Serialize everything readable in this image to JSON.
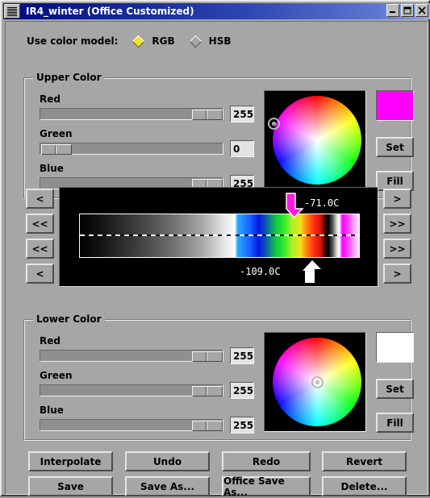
{
  "window": {
    "title": "IR4_winter (Office Customized)",
    "sysmenu_icon": "menu-lines-icon",
    "minimize_label": "minimize-icon",
    "maximize_label": "maximize-icon",
    "close_label": "close-icon",
    "titlebar_color": "#2a44b0",
    "face_color": "#a6a6a6"
  },
  "color_model": {
    "label": "Use color model:",
    "options": [
      {
        "label": "RGB",
        "selected": true,
        "marker_color": "#f5e32a"
      },
      {
        "label": "HSB",
        "selected": false,
        "marker_color": "#a6a6a6"
      }
    ]
  },
  "upper_color": {
    "group_label": "Upper Color",
    "channels": [
      {
        "label": "Red",
        "value": "255",
        "percent": 100
      },
      {
        "label": "Green",
        "value": "0",
        "percent": 0
      },
      {
        "label": "Blue",
        "value": "255",
        "percent": 100
      }
    ],
    "swatch_color": "#ff00ff",
    "cursor": {
      "x_pct": 8,
      "y_pct": 30
    },
    "set_label": "Set",
    "fill_label": "Fill"
  },
  "lower_color": {
    "group_label": "Lower Color",
    "channels": [
      {
        "label": "Red",
        "value": "255",
        "percent": 100
      },
      {
        "label": "Green",
        "value": "255",
        "percent": 100
      },
      {
        "label": "Blue",
        "value": "255",
        "percent": 100
      }
    ],
    "swatch_color": "#ffffff",
    "cursor": {
      "x_pct": 50,
      "y_pct": 50
    },
    "set_label": "Set",
    "fill_label": "Fill"
  },
  "spectrum": {
    "upper_marker": {
      "label": "-71.0C",
      "color": "#ff1ae0",
      "position_pct": 79.5
    },
    "lower_marker": {
      "label": "-109.0C",
      "color": "#ffffff",
      "position_pct": 85.5
    },
    "gradient_css": "linear-gradient(to right, #000000 0%, #101010 6%, #3c3c3c 20%, #6e6e6e 33%, #a8a8a8 44%, #e0e0e0 51%, #ffffff 55.5%, #2fa8ff 56.5%, #1460ff 61%, #0a18e8 64%, #0b46c0 66%, #13c24a 70%, #2aee2a 73%, #a8f02a 76%, #f0e018 79%, #ff8c10 81%, #ff2a10 84%, #d01008 86.5%, #2a0604 88%, #000000 89%, #555555 90.5%, #d8d8d8 92%, #ffffff 93%, #ff00ff 94%, #ff3cff 96%, #ff9cff 98%, #ffe6ff 100%)"
  },
  "nav_buttons": {
    "left": [
      "<",
      "<<",
      "<<",
      "<"
    ],
    "right": [
      ">",
      ">>",
      ">>",
      ">"
    ]
  },
  "actions": {
    "row1": [
      "Interpolate",
      "Undo",
      "Redo",
      "Revert"
    ],
    "row2": [
      "Save",
      "Save As...",
      "Office Save As...",
      "Delete..."
    ]
  }
}
